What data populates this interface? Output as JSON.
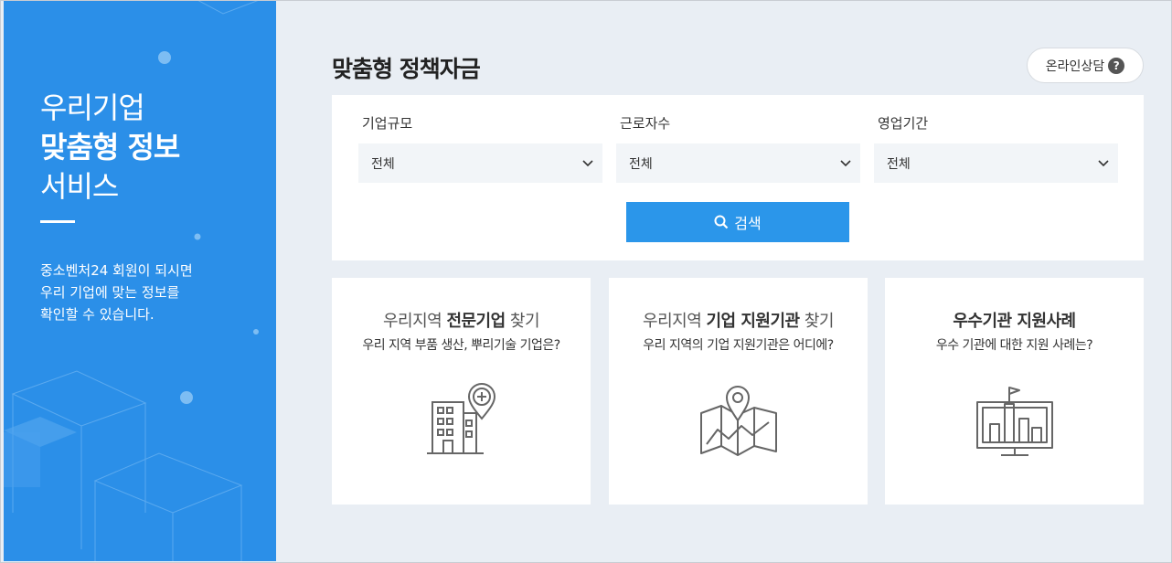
{
  "hero": {
    "line1": "우리기업",
    "line2": "맞춤형 정보",
    "line3": "서비스",
    "desc": [
      "중소벤처24 회원이 되시면",
      "우리 기업에 맞는 정보를",
      "확인할 수 있습니다."
    ]
  },
  "main": {
    "title": "맞춤형 정책자금",
    "consult_label": "온라인상담",
    "filters": [
      {
        "label": "기업규모",
        "value": "전체"
      },
      {
        "label": "근로자수",
        "value": "전체"
      },
      {
        "label": "영업기간",
        "value": "전체"
      }
    ],
    "search_label": "검색"
  },
  "cards": [
    {
      "title_pre": "우리지역 ",
      "title_bold": "전문기업",
      "title_post": " 찾기",
      "sub": "우리 지역 부품 생산, 뿌리기술 기업은?",
      "icon": "building-pin-icon"
    },
    {
      "title_pre": "우리지역 ",
      "title_bold": "기업 지원기관",
      "title_post": " 찾기",
      "sub": "우리 지역의 기업 지원기관은 어디에?",
      "icon": "map-pin-icon"
    },
    {
      "title_pre": "",
      "title_bold": "우수기관 지원사례",
      "title_post": "",
      "sub": "우수 기관에 대한 지원 사례는?",
      "icon": "monitor-chart-icon"
    }
  ],
  "colors": {
    "accent": "#2b96ea",
    "panel": "#2b8fe8",
    "background": "#e9eef4"
  }
}
